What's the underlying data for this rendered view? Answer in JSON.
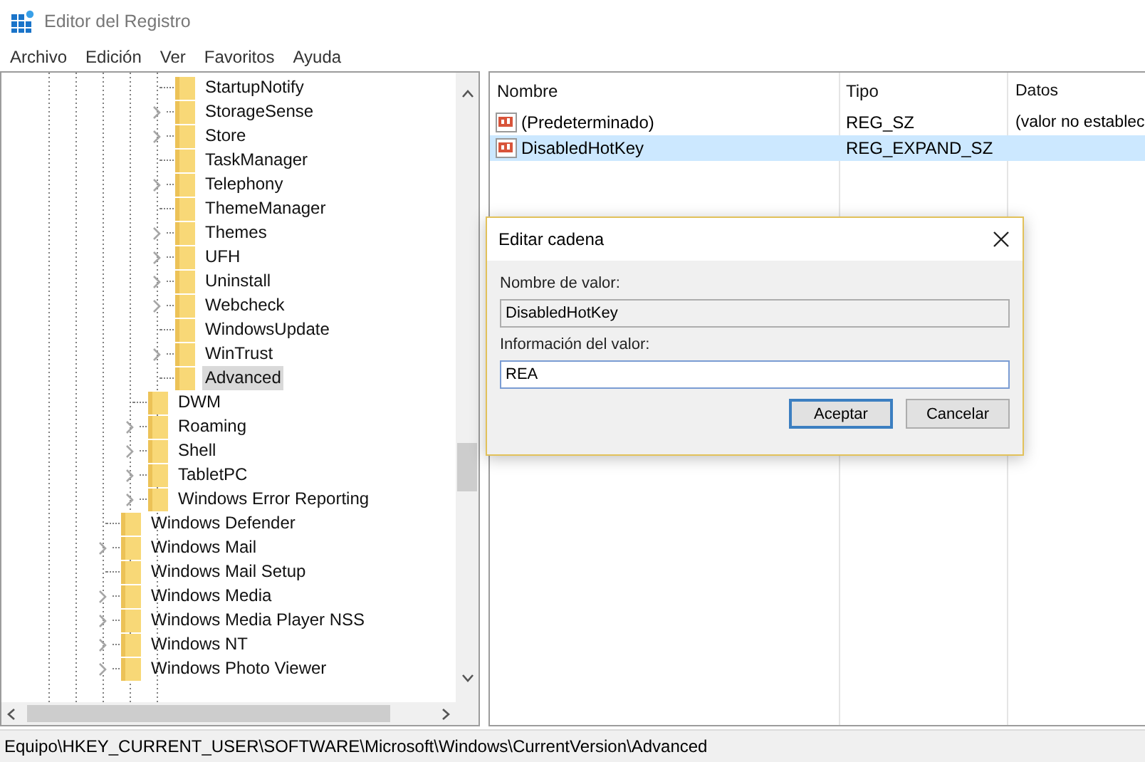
{
  "window": {
    "title": "Editor del Registro"
  },
  "menu": [
    "Archivo",
    "Edición",
    "Ver",
    "Favoritos",
    "Ayuda"
  ],
  "tree": [
    {
      "children": [
        {
          "children": [
            {
              "label": "StartupNotify",
              "expandable": false,
              "selected": false
            },
            {
              "label": "StorageSense",
              "expandable": true,
              "selected": false
            },
            {
              "label": "Store",
              "expandable": true,
              "selected": false
            },
            {
              "label": "TaskManager",
              "expandable": false,
              "selected": false
            },
            {
              "label": "Telephony",
              "expandable": true,
              "selected": false
            },
            {
              "label": "ThemeManager",
              "expandable": false,
              "selected": false
            },
            {
              "label": "Themes",
              "expandable": true,
              "selected": false
            },
            {
              "label": "UFH",
              "expandable": true,
              "selected": false
            },
            {
              "label": "Uninstall",
              "expandable": true,
              "selected": false
            },
            {
              "label": "Webcheck",
              "expandable": true,
              "selected": false
            },
            {
              "label": "WindowsUpdate",
              "expandable": false,
              "selected": false
            },
            {
              "label": "WinTrust",
              "expandable": true,
              "selected": false
            },
            {
              "label": "Advanced",
              "expandable": false,
              "selected": true
            }
          ]
        },
        {
          "label": "DWM",
          "expandable": false,
          "selected": false
        },
        {
          "label": "Roaming",
          "expandable": true,
          "selected": false
        },
        {
          "label": "Shell",
          "expandable": true,
          "selected": false
        },
        {
          "label": "TabletPC",
          "expandable": true,
          "selected": false
        },
        {
          "label": "Windows Error Reporting",
          "expandable": true,
          "selected": false
        }
      ]
    },
    {
      "label": "Windows Defender",
      "expandable": false,
      "selected": false
    },
    {
      "label": "Windows Mail",
      "expandable": true,
      "selected": false
    },
    {
      "label": "Windows Mail Setup",
      "expandable": false,
      "selected": false
    },
    {
      "label": "Windows Media",
      "expandable": true,
      "selected": false
    },
    {
      "label": "Windows Media Player NSS",
      "expandable": true,
      "selected": false
    },
    {
      "label": "Windows NT",
      "expandable": true,
      "selected": false
    },
    {
      "label": "Windows Photo Viewer",
      "expandable": true,
      "selected": false
    }
  ],
  "values_list": {
    "columns": [
      "Nombre",
      "Tipo",
      "Datos"
    ],
    "rows": [
      {
        "name": "(Predeterminado)",
        "type": "REG_SZ",
        "data": "(valor no establec",
        "selected": false
      },
      {
        "name": "DisabledHotKey",
        "type": "REG_EXPAND_SZ",
        "selected": true
      }
    ]
  },
  "dialog": {
    "title": "Editar cadena",
    "fields": [
      {
        "label": "Nombre de valor:",
        "value": "DisabledHotKey",
        "disabled": true
      },
      {
        "label": "Información del valor:",
        "value": "REA",
        "disabled": false
      }
    ],
    "buttons": [
      {
        "label": "Aceptar",
        "default": true
      },
      {
        "label": "Cancelar",
        "default": false
      }
    ]
  },
  "status_bar": "Equipo\\HKEY_CURRENT_USER\\SOFTWARE\\Microsoft\\Windows\\CurrentVersion\\Advanced"
}
